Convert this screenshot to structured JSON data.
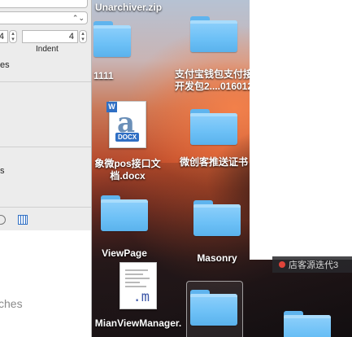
{
  "inspector": {
    "tab_width_value": "4",
    "indent_value": "4",
    "indent_label": "Indent",
    "truncated_label_1": "es",
    "truncated_label_2": "s",
    "bottom_truncated_text": "ches"
  },
  "desktop": {
    "items": [
      {
        "label": "Unarchiver.zip"
      },
      {
        "label": "1111"
      },
      {
        "label_line1": "支付宝钱包支付接",
        "label_line2": "开发包2....016012"
      },
      {
        "label_line1": "象微pos接口文",
        "label_line2": "档.docx",
        "badge": "DOCX",
        "w_badge": "W"
      },
      {
        "label": "微创客推送证书"
      },
      {
        "label": "ViewPage"
      },
      {
        "label": "Masonry"
      },
      {
        "label": "MianViewManager.",
        "file_letter": ".m"
      }
    ],
    "notification_text": "店客源迭代3"
  },
  "colors": {
    "folder_blue": "#6cc0f6",
    "badge_red": "#e0443a",
    "docx_blue": "#2f6fc4"
  }
}
